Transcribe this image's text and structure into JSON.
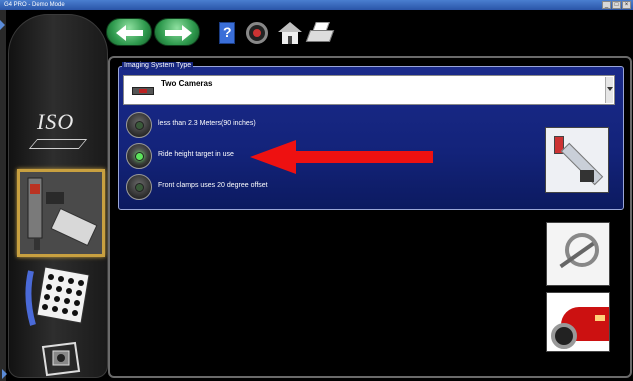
{
  "window": {
    "title": "G4 PRO - Demo Mode",
    "controls": [
      "_",
      "□",
      "×"
    ]
  },
  "toolbar": {
    "icons": [
      "back-arrow-icon",
      "forward-arrow-icon",
      "help-book-icon",
      "wheel-icon",
      "home-icon",
      "print-icon"
    ]
  },
  "sidebar": {
    "iso_label": "ISO",
    "items": [
      "iso-view",
      "imaging-system",
      "target-setup",
      "camera-setup"
    ],
    "selected": "imaging-system"
  },
  "imaging_system": {
    "group_title": "Imaging System Type",
    "selected_value": "Two Cameras",
    "options": [
      {
        "label": "less than 2.3 Meters(90 inches)",
        "selected": false
      },
      {
        "label": "Ride height target in use",
        "selected": true
      },
      {
        "label": "Front clamps uses 20 degree offset",
        "selected": false
      }
    ]
  },
  "colors": {
    "panel_blue": "#13237a",
    "highlight_arrow": "#ee1111",
    "selected_border": "#c8a040",
    "radio_on": "#5ce65c"
  }
}
